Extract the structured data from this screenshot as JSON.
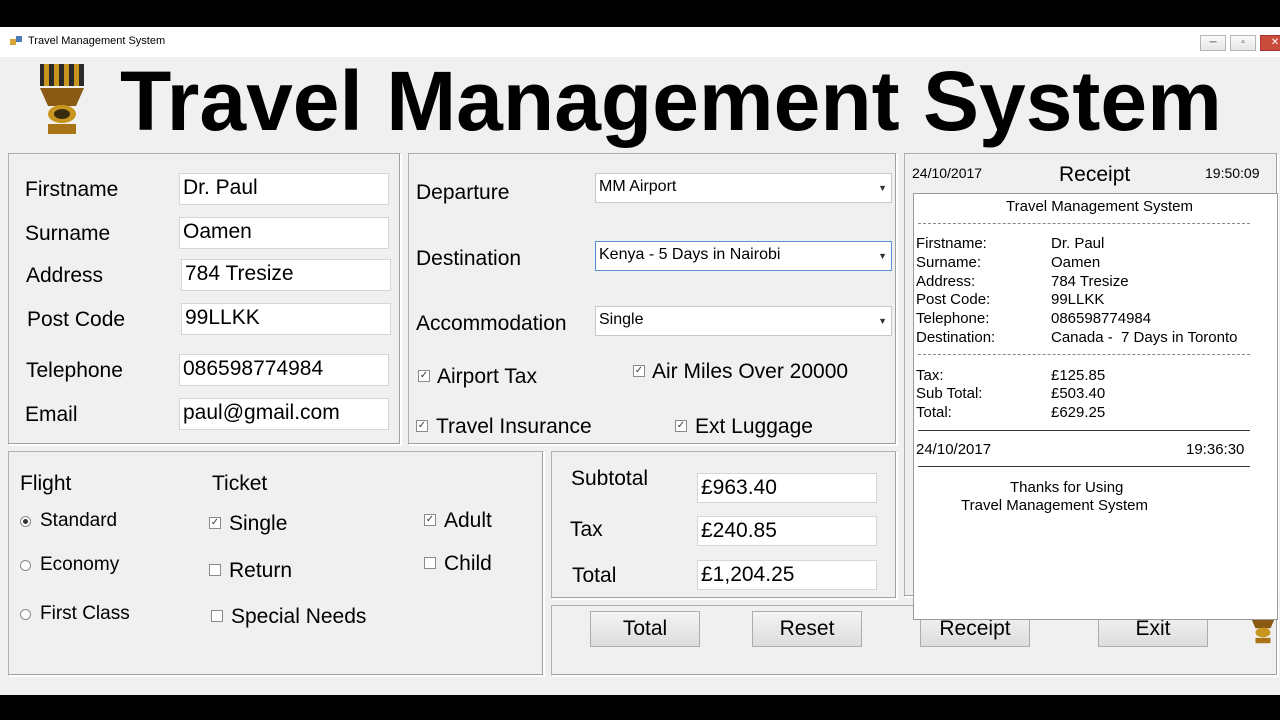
{
  "window": {
    "title": "Travel Management System"
  },
  "banner": {
    "title": "Travel Management System"
  },
  "customer": {
    "firstname_label": "Firstname",
    "firstname": "Dr. Paul",
    "surname_label": "Surname",
    "surname": "Oamen",
    "address_label": "Address",
    "address": "784 Tresize",
    "postcode_label": "Post Code",
    "postcode": "99LLKK",
    "telephone_label": "Telephone",
    "telephone": "086598774984",
    "email_label": "Email",
    "email": "paul@gmail.com"
  },
  "trip": {
    "departure_label": "Departure",
    "departure": "MM Airport",
    "destination_label": "Destination",
    "destination": "Kenya - 5 Days in Nairobi",
    "accommodation_label": "Accommodation",
    "accommodation": "Single",
    "airport_tax": "Airport Tax",
    "air_miles": "Air Miles Over 20000",
    "travel_insurance": "Travel Insurance",
    "ext_luggage": "Ext Luggage"
  },
  "flight": {
    "heading": "Flight",
    "standard": "Standard",
    "economy": "Economy",
    "first_class": "First Class",
    "selected": "Standard"
  },
  "ticket": {
    "heading": "Ticket",
    "single": "Single",
    "return": "Return",
    "special_needs": "Special Needs",
    "adult": "Adult",
    "child": "Child"
  },
  "costs": {
    "subtotal_label": "Subtotal",
    "subtotal": "£963.40",
    "tax_label": "Tax",
    "tax": "£240.85",
    "total_label": "Total",
    "total": "£1,204.25"
  },
  "buttons": {
    "total": "Total",
    "reset": "Reset",
    "receipt": "Receipt",
    "exit": "Exit"
  },
  "receipt": {
    "date": "24/10/2017",
    "heading": "Receipt",
    "time": "19:50:09",
    "title": "Travel Management System",
    "firstname_label": "Firstname:",
    "firstname": "Dr. Paul",
    "surname_label": "Surname:",
    "surname": "Oamen",
    "address_label": "Address:",
    "address": "784 Tresize",
    "postcode_label": "Post Code:",
    "postcode": "99LLKK",
    "telephone_label": "Telephone:",
    "telephone": "086598774984",
    "destination_label": "Destination:",
    "destination": "Canada -  7 Days in Toronto",
    "tax_label": "Tax:",
    "tax": "£125.85",
    "subtotal_label": "Sub Total:",
    "subtotal": "£503.40",
    "total_label": "Total:",
    "total": "£629.25",
    "footer_date": "24/10/2017",
    "footer_time": "19:36:30",
    "thanks_line1": "Thanks for Using",
    "thanks_line2": "Travel Management System"
  },
  "colors": {
    "window_bg": "#f0f0f0",
    "logo_gold": "#c8961e"
  },
  "icons": {
    "app": "app-icon",
    "logo": "trophy-logo-icon",
    "minimize": "minimize-icon",
    "maximize": "maximize-icon",
    "close": "close-icon"
  }
}
